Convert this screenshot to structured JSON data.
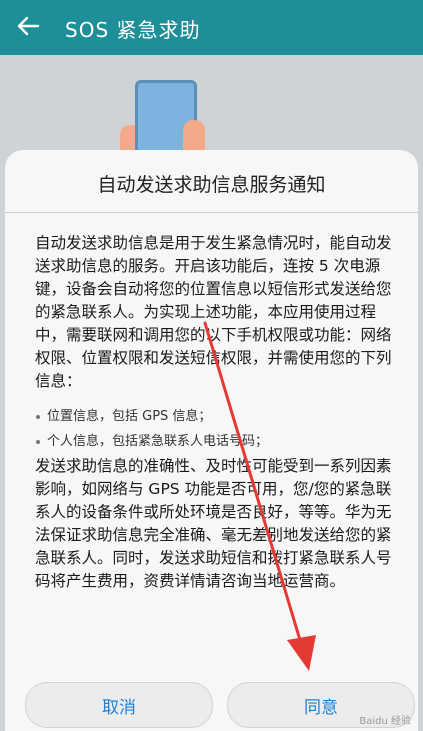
{
  "appbar": {
    "title": "SOS 紧急求助"
  },
  "dialog": {
    "title": "自动发送求助信息服务通知",
    "paragraph1": "自动发送求助信息是用于发生紧急情况时，能自动发送求助信息的服务。开启该功能后，连按 5 次电源键，设备会自动将您的位置信息以短信形式发送给您的紧急联系人。为实现上述功能，本应用使用过程中，需要联网和调用您的以下手机权限或功能：网络权限、位置权限和发送短信权限，并需使用您的下列信息：",
    "bullets": [
      "位置信息，包括 GPS 信息；",
      "个人信息，包括紧急联系人电话号码；"
    ],
    "paragraph2": "发送求助信息的准确性、及时性可能受到一系列因素影响，如网络与 GPS 功能是否可用，您/您的紧急联系人的设备条件或所处环境是否良好，等等。华为无法保证求助信息完全准确、毫无差别地发送给您的紧急联系人。同时，发送求助短信和拨打紧急联系人号码将产生费用，资费详情请咨询当地运营商。",
    "cancel_label": "取消",
    "agree_label": "同意"
  },
  "colors": {
    "appbar": "#1e8f98",
    "button_text": "#1e7fd2",
    "annotation_arrow": "#e53935"
  },
  "icons": {
    "back": "arrow-left-icon"
  }
}
